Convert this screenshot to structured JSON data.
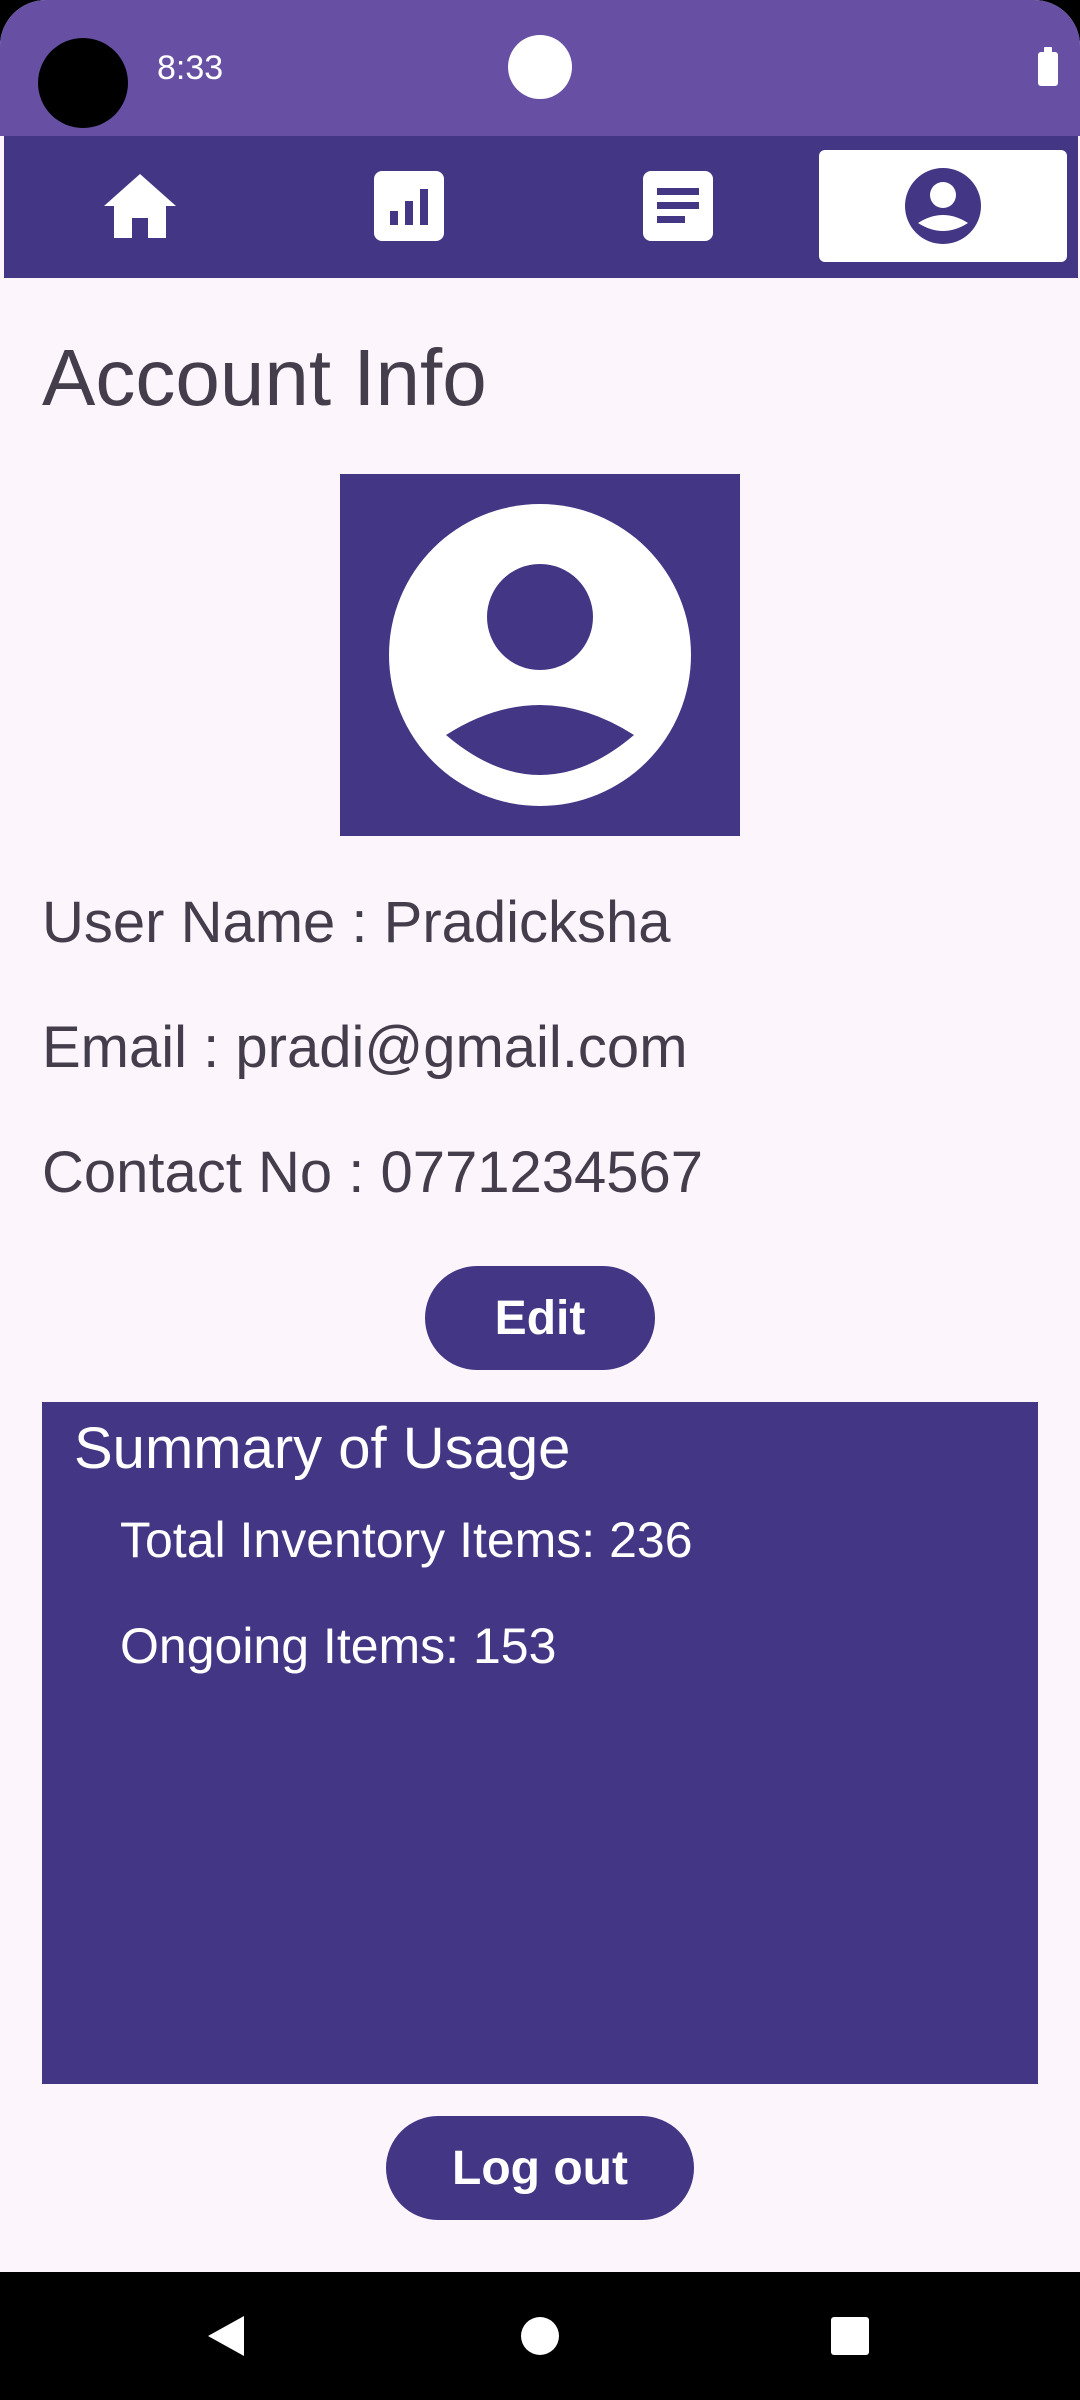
{
  "status_bar": {
    "time": "8:33"
  },
  "top_nav": {
    "items": [
      {
        "icon": "home-icon",
        "active": false
      },
      {
        "icon": "bar-chart-icon",
        "active": false
      },
      {
        "icon": "document-icon",
        "active": false
      },
      {
        "icon": "account-icon",
        "active": true
      }
    ]
  },
  "page": {
    "title": "Account Info",
    "avatar_icon": "account-circle-icon"
  },
  "user": {
    "name_line": "User Name : Pradicksha",
    "email_line": "Email : pradi@gmail.com",
    "contact_line": "Contact No : 0771234567"
  },
  "actions": {
    "edit_label": "Edit",
    "logout_label": "Log out"
  },
  "summary": {
    "title": "Summary of Usage",
    "total_inventory": "Total Inventory Items: 236",
    "ongoing_items": "Ongoing Items: 153"
  },
  "colors": {
    "primary": "#423685",
    "status_bar": "#6750a4",
    "background": "#fcf5fb",
    "text": "#443e4c"
  },
  "system_nav": {
    "buttons": [
      "back-icon",
      "home-circle-icon",
      "recents-icon"
    ]
  }
}
